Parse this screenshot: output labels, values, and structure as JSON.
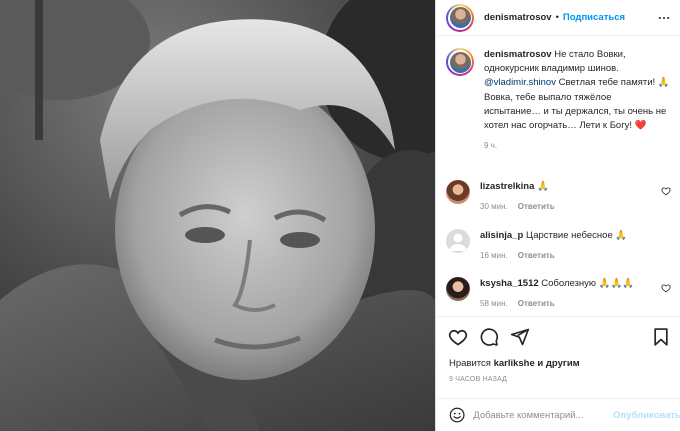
{
  "header": {
    "username": "denismatrosov",
    "separator": "•",
    "follow_label": "Подписаться",
    "more_icon": "more-horizontal-icon"
  },
  "caption": {
    "username": "denismatrosov",
    "text_1": "Не стало Вовки, однокурсник владимир шинов.",
    "mention": "@vladimir.shinov",
    "text_2": "Светлая тебе памяти! 🙏 Вовка, тебе выпало тяжёлое испытание… и ты держался, ты очень не хотел нас огорчать… Лети к Богу! ❤️",
    "time": "9 ч."
  },
  "comments": [
    {
      "username": "lizastrelkina",
      "text": "🙏",
      "time": "30 мин.",
      "reply_label": "Ответить"
    },
    {
      "username": "alisinja_p",
      "text": "Царствие небесное 🙏",
      "time": "16 мин.",
      "reply_label": "Ответить"
    },
    {
      "username": "ksysha_1512",
      "text": "Соболезную 🙏🙏🙏",
      "time": "58 мин.",
      "reply_label": "Ответить"
    }
  ],
  "actions": {
    "like_icon": "heart-icon",
    "comment_icon": "comment-icon",
    "share_icon": "share-icon",
    "save_icon": "bookmark-icon"
  },
  "likes": {
    "prefix": "Нравится",
    "user": "karlikshe",
    "suffix": "и другим"
  },
  "post_date": "9 ЧАСОВ НАЗАД",
  "add_comment": {
    "emoji_icon": "smiley-icon",
    "placeholder": "Добавьте комментарий...",
    "publish_label": "Опубликовать"
  },
  "colors": {
    "accent": "#0095f6",
    "text": "#262626",
    "muted": "#8e8e8e",
    "publish_disabled": "#b2dffc",
    "heart_red": "#ed4956"
  }
}
